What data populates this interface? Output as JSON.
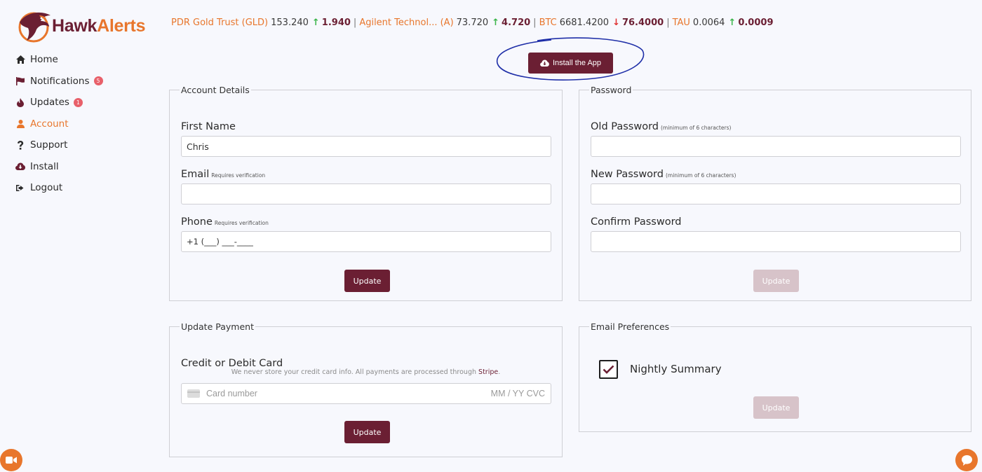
{
  "brand": {
    "name_part1": "Hawk",
    "name_part2": "Alerts",
    "accent": "#e8762c",
    "primary": "#6b1f33"
  },
  "sidebar": {
    "items": [
      {
        "label": "Home",
        "icon": "home-icon"
      },
      {
        "label": "Notifications",
        "icon": "flag-icon",
        "badge": "5"
      },
      {
        "label": "Updates",
        "icon": "fire-icon",
        "badge": "1"
      },
      {
        "label": "Account",
        "icon": "user-icon",
        "active": true
      },
      {
        "label": "Support",
        "icon": "question-icon"
      },
      {
        "label": "Install",
        "icon": "cloud-download-icon"
      },
      {
        "label": "Logout",
        "icon": "logout-icon"
      }
    ]
  },
  "ticker": [
    {
      "name": "PDR Gold Trust (GLD)",
      "price": "153.240",
      "direction": "up",
      "change": "1.940"
    },
    {
      "name": "Agilent Technol... (A)",
      "price": "73.720",
      "direction": "up",
      "change": "4.720"
    },
    {
      "name": "BTC",
      "price": "6681.4200",
      "direction": "down",
      "change": "76.4000"
    },
    {
      "name": "TAU",
      "price": "0.0064",
      "direction": "up",
      "change": "0.0009"
    }
  ],
  "install_button": {
    "label": "Install the App"
  },
  "account": {
    "legend": "Account Details",
    "first_name_label": "First Name",
    "first_name_value": "Chris",
    "email_label": "Email",
    "email_note": "Requires verification",
    "email_value": "",
    "phone_label": "Phone",
    "phone_note": "Requires verification",
    "phone_value": "+1 (___) ___-____",
    "update_label": "Update"
  },
  "password": {
    "legend": "Password",
    "old_label": "Old Password",
    "old_note": "(minimum of 6 characters)",
    "new_label": "New Password",
    "new_note": "(minimum of 6 characters)",
    "confirm_label": "Confirm Password",
    "update_label": "Update"
  },
  "payment": {
    "legend": "Update Payment",
    "card_label": "Credit or Debit Card",
    "note_text": "We never store your credit card info. All payments are processed through",
    "note_link": "Stripe",
    "note_end": ".",
    "card_placeholder": "Card number",
    "expiry_cvc_placeholder": "MM / YY  CVC",
    "update_label": "Update"
  },
  "email_prefs": {
    "legend": "Email Preferences",
    "nightly_label": "Nightly Summary",
    "nightly_checked": true,
    "update_label": "Update"
  }
}
